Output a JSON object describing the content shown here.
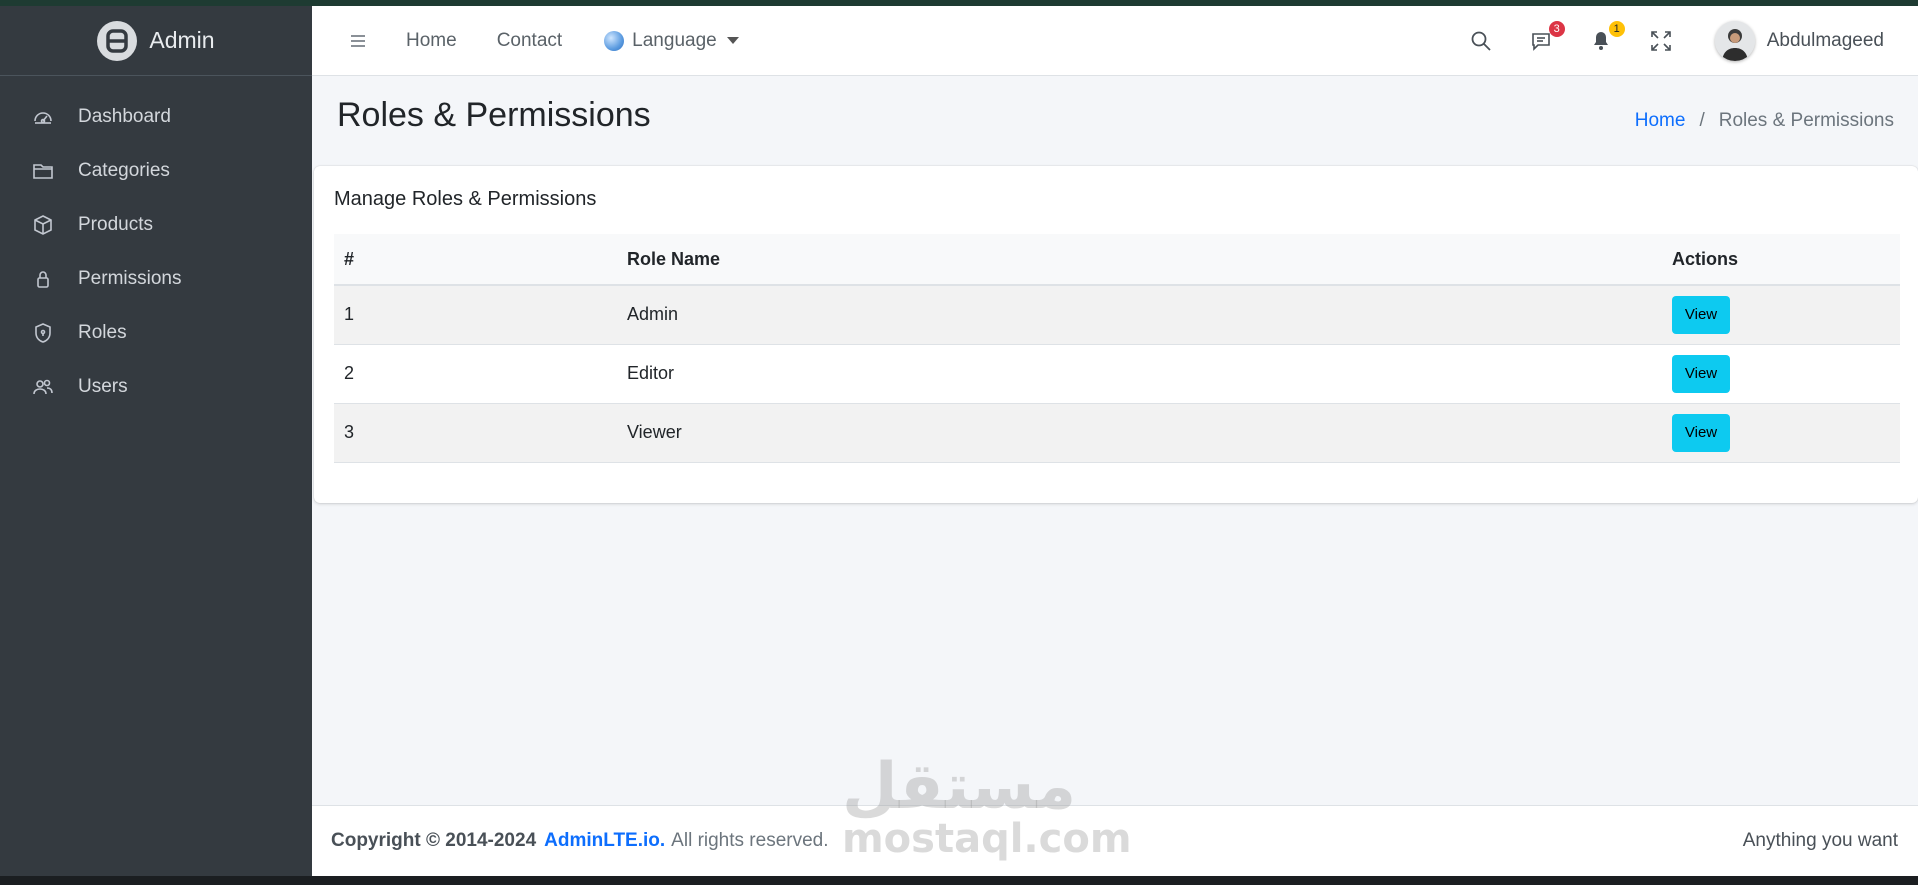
{
  "brand": {
    "name": "Admin"
  },
  "sidebar": {
    "items": [
      {
        "label": "Dashboard",
        "icon": "dashboard-icon"
      },
      {
        "label": "Categories",
        "icon": "folder-icon"
      },
      {
        "label": "Products",
        "icon": "box-icon"
      },
      {
        "label": "Permissions",
        "icon": "lock-icon"
      },
      {
        "label": "Roles",
        "icon": "shield-icon"
      },
      {
        "label": "Users",
        "icon": "users-icon"
      }
    ]
  },
  "navbar": {
    "links": [
      "Home",
      "Contact"
    ],
    "language_label": "Language",
    "messages_badge": "3",
    "notifications_badge": "1",
    "user_name": "Abdulmageed"
  },
  "page": {
    "title": "Roles & Permissions",
    "breadcrumb": {
      "home": "Home",
      "separator": "/",
      "current": "Roles & Permissions"
    }
  },
  "card": {
    "title": "Manage Roles & Permissions",
    "table": {
      "headers": [
        "#",
        "Role Name",
        "Actions"
      ],
      "rows": [
        {
          "num": "1",
          "name": "Admin",
          "action": "View"
        },
        {
          "num": "2",
          "name": "Editor",
          "action": "View"
        },
        {
          "num": "3",
          "name": "Viewer",
          "action": "View"
        }
      ]
    }
  },
  "footer": {
    "copyright": "Copyright © 2014-2024",
    "link": "AdminLTE.io.",
    "rights": "All rights reserved.",
    "right_text": "Anything you want"
  },
  "watermark": {
    "arabic": "مستقل",
    "latin": "mostaql.com"
  },
  "colors": {
    "sidebar_bg": "#343a40",
    "link_blue": "#0d6efd",
    "view_button": "#0dcaf0",
    "badge_red": "#dc3545",
    "badge_yellow": "#ffc107"
  }
}
